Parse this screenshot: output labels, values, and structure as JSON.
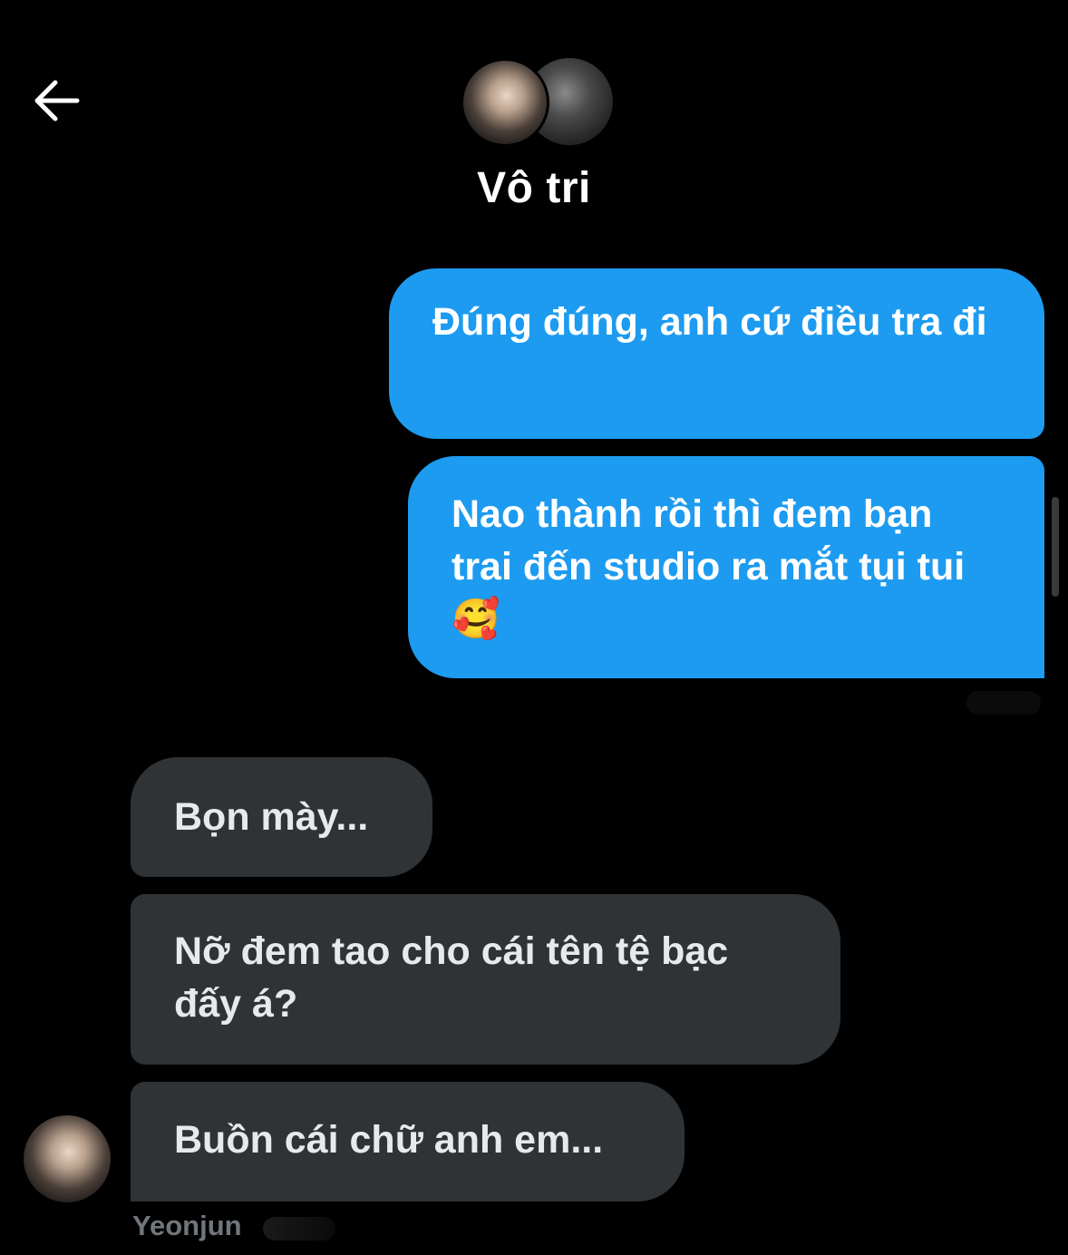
{
  "header": {
    "title": "Vô tri",
    "back_icon": "arrow-left-icon"
  },
  "messages": [
    {
      "direction": "sent",
      "text": "Đúng đúng, anh cứ điều tra đi"
    },
    {
      "direction": "sent",
      "text": "Nao thành rồi thì đem bạn trai đến studio ra mắt tụi tui 🥰"
    },
    {
      "direction": "received",
      "text": "Bọn mày..."
    },
    {
      "direction": "received",
      "text": "Nỡ đem tao cho cái tên tệ bạc đấy á?"
    },
    {
      "direction": "received",
      "text": "Buồn cái chữ anh em..."
    }
  ],
  "sender": {
    "name": "Yeonjun"
  },
  "colors": {
    "background": "#000000",
    "sent_bubble": "#1d9bf0",
    "received_bubble": "#2f3336",
    "sender_name": "#71767b"
  }
}
